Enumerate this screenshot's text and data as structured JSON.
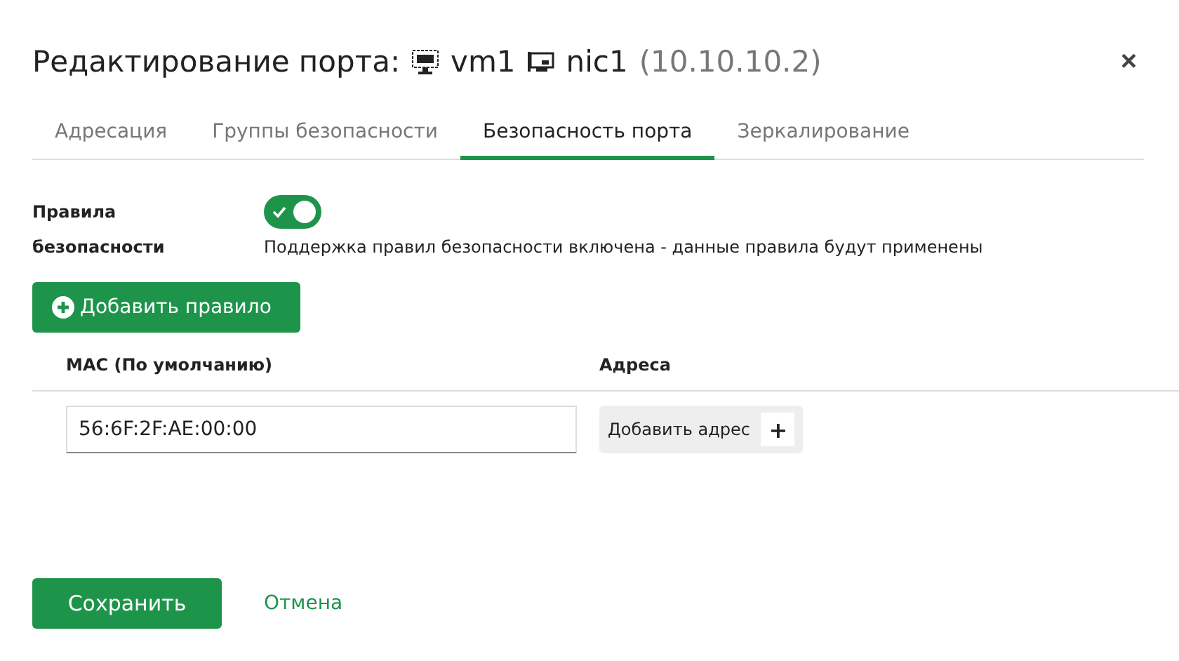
{
  "dialog": {
    "title": "Редактирование порта:",
    "vm": "vm1",
    "nic": "nic1",
    "address": "(10.10.10.2)",
    "close": "×"
  },
  "tabs": [
    {
      "label": "Адресация",
      "selected": false
    },
    {
      "label": "Группы безопасности",
      "selected": false
    },
    {
      "label": "Безопасность порта",
      "selected": true
    },
    {
      "label": "Зеркалирование",
      "selected": false
    }
  ],
  "security": {
    "label": "Правила безопасности",
    "on": true,
    "description": "Поддержка правил безопасности включена - данные правила будут применены"
  },
  "add_rule_button": "Добавить правило",
  "table": {
    "columns": [
      "MAC (По умолчанию)",
      "Адреса"
    ],
    "rows": [
      {
        "mac": "56:6F:2F:AE:00:00",
        "add_address": "Добавить адрес",
        "plus": "+"
      }
    ]
  },
  "buttons": {
    "save": "Сохранить",
    "cancel": "Отмена"
  }
}
